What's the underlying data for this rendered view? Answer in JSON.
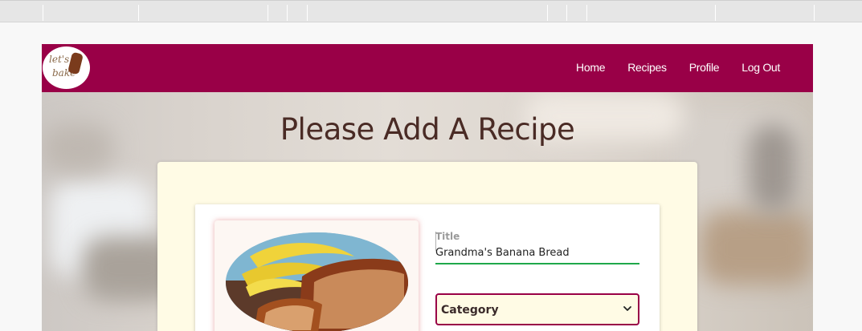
{
  "nav": {
    "items": [
      {
        "label": "Home"
      },
      {
        "label": "Recipes"
      },
      {
        "label": "Profile"
      },
      {
        "label": "Log Out"
      }
    ]
  },
  "logo": {
    "line1": "let's",
    "line2": "bake"
  },
  "page": {
    "title": "Please Add A Recipe"
  },
  "form": {
    "title_label": "Title",
    "title_value": "Grandma's Banana Bread",
    "category_selected": "Category"
  },
  "colors": {
    "brand": "#990047",
    "card": "#fffbe5",
    "title_text": "#4a2b25",
    "input_underline": "#1fa84a"
  },
  "icons": {
    "select": "chevron-down-icon",
    "image": "banana-bread-photo"
  }
}
